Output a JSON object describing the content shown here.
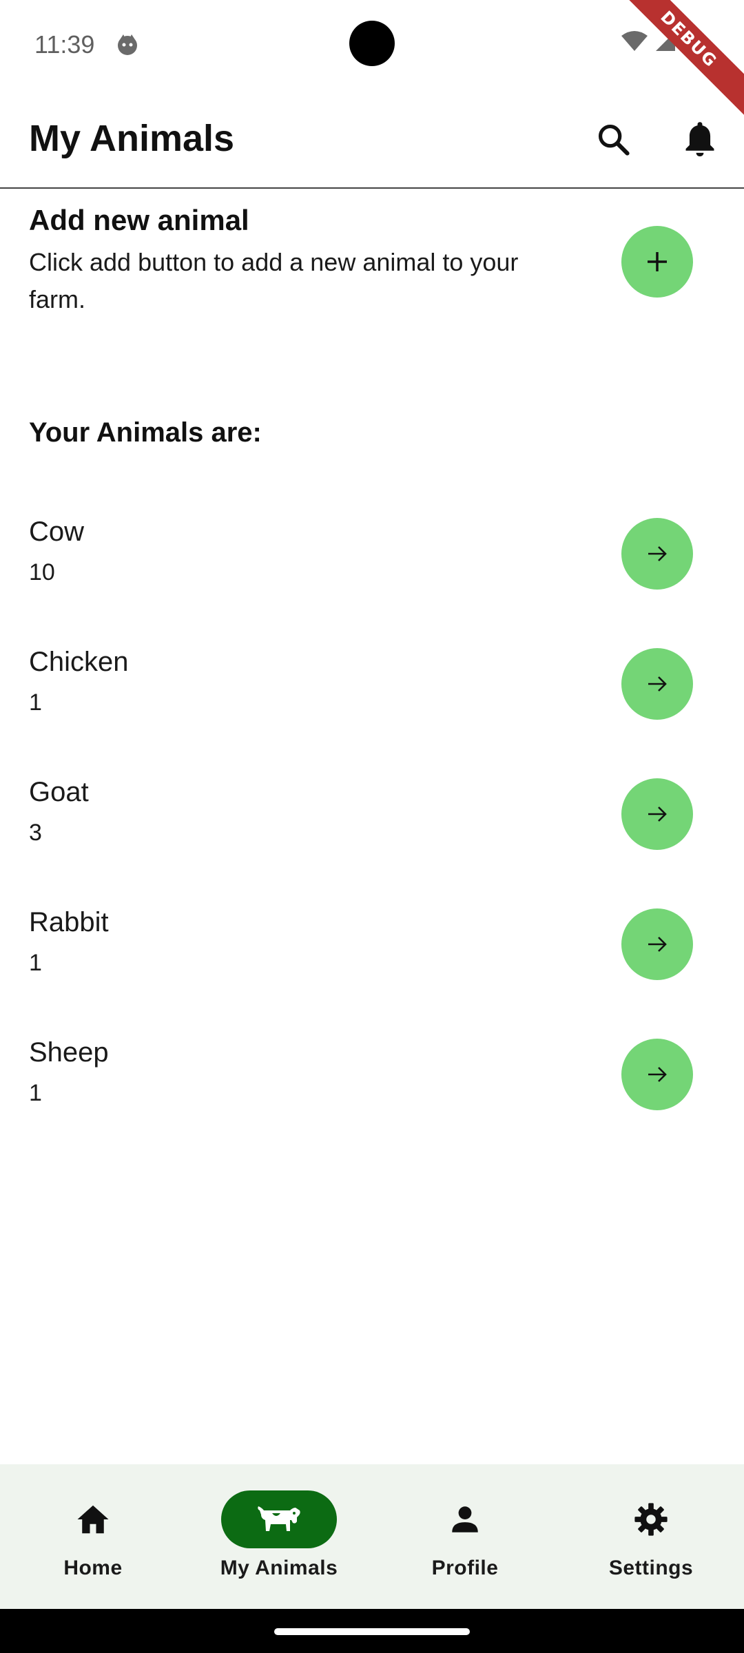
{
  "status_bar": {
    "time": "11:39",
    "debug_label": "DEBUG"
  },
  "app_bar": {
    "title": "My Animals",
    "icons": [
      "search-icon",
      "bell-icon"
    ]
  },
  "add_section": {
    "title": "Add new animal",
    "description": "Click add button to add a new animal to your farm."
  },
  "list_heading": "Your Animals are:",
  "animals": [
    {
      "name": "Cow",
      "count": "10"
    },
    {
      "name": "Chicken",
      "count": "1"
    },
    {
      "name": "Goat",
      "count": "3"
    },
    {
      "name": "Rabbit",
      "count": "1"
    },
    {
      "name": "Sheep",
      "count": "1"
    }
  ],
  "bottom_nav": {
    "items": [
      {
        "label": "Home",
        "icon": "home-icon"
      },
      {
        "label": "My Animals",
        "icon": "cow-icon",
        "active": true
      },
      {
        "label": "Profile",
        "icon": "person-icon"
      },
      {
        "label": "Settings",
        "icon": "gear-icon"
      }
    ]
  },
  "colors": {
    "accent_button": "#74d576",
    "nav_active": "#0c6b13",
    "nav_background": "#eff4ee"
  }
}
